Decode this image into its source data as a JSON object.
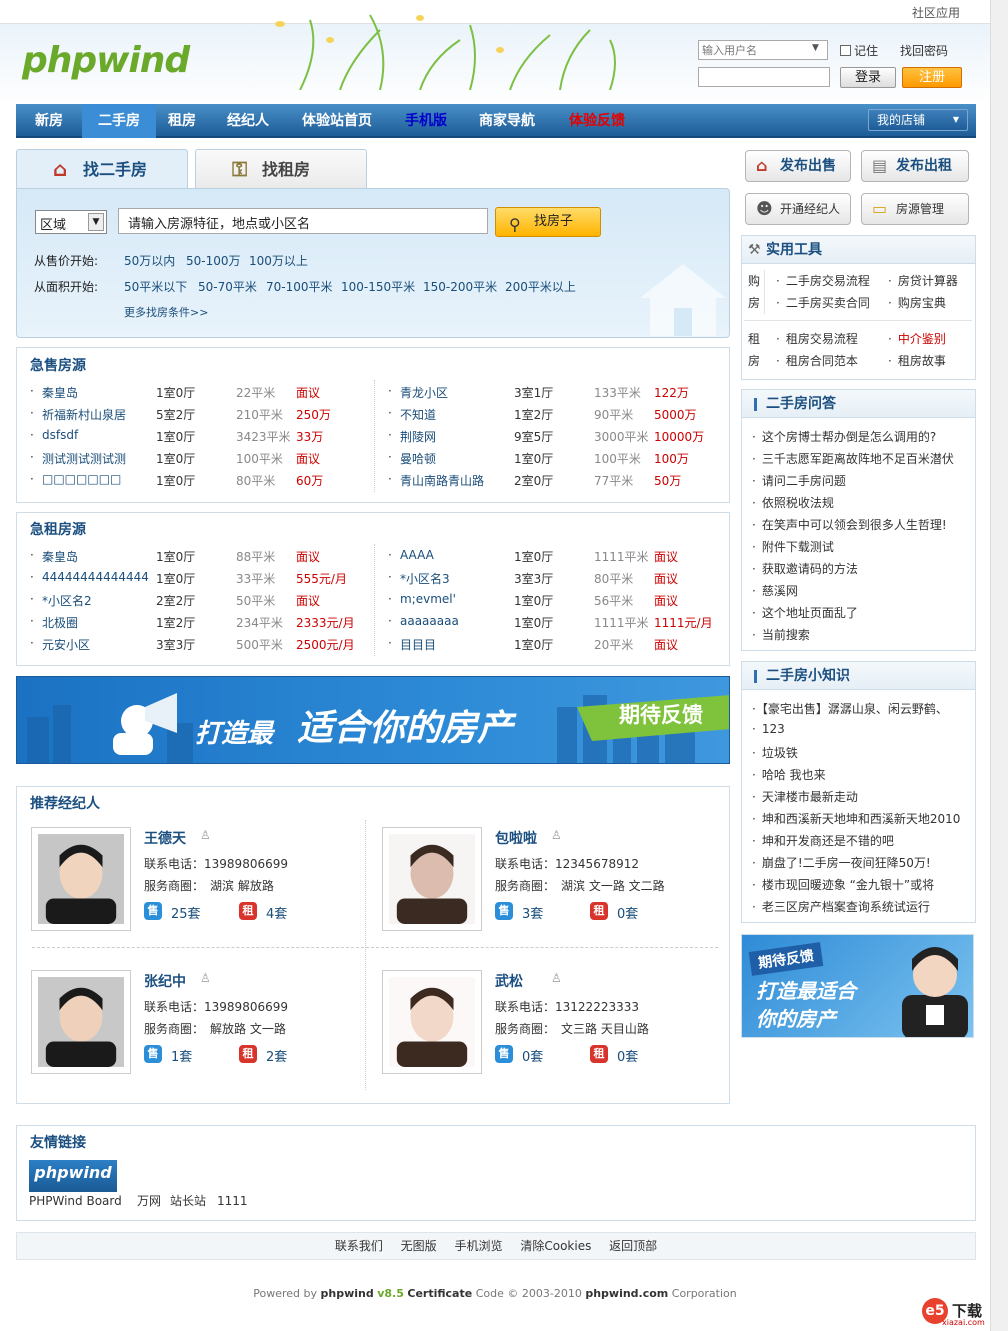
{
  "topbar": {
    "app_label": "社区应用"
  },
  "brand": {
    "logo_text": "phpwind"
  },
  "login": {
    "user_placeholder": "输入用户名",
    "remember_label": "记住",
    "find_password": "找回密码",
    "login_button": "登录",
    "register_button": "注册"
  },
  "nav": {
    "items": [
      "新房",
      "二手房",
      "租房",
      "经纪人",
      "体验站首页",
      "手机版",
      "商家导航",
      "体验反馈"
    ],
    "active": "二手房",
    "my_shop": "我的店铺"
  },
  "search": {
    "tabs": [
      "找二手房",
      "找租房"
    ],
    "area_select": "区域",
    "keyword_placeholder": "请输入房源特征，地点或小区名",
    "button": "找房子",
    "price_label": "从售价开始:",
    "price_options": [
      "50万以内",
      "50-100万",
      "100万以上"
    ],
    "area_label": "从面积开始:",
    "area_options": [
      "50平米以下",
      "50-70平米",
      "70-100平米",
      "100-150平米",
      "150-200平米",
      "200平米以上"
    ],
    "more": "更多找房条件>>"
  },
  "urgent_sale": {
    "title": "急售房源",
    "left": [
      {
        "name": "秦皇岛",
        "layout": "1室0厅",
        "size": "22平米",
        "price": "面议"
      },
      {
        "name": "祈福新村山泉居",
        "layout": "5室2厅",
        "size": "210平米",
        "price": "250万"
      },
      {
        "name": "dsfsdf",
        "layout": "1室0厅",
        "size": "3423平米",
        "price": "33万"
      },
      {
        "name": "测试测试测试测",
        "layout": "1室0厅",
        "size": "100平米",
        "price": "面议"
      },
      {
        "name": "□□□□□□□",
        "layout": "1室0厅",
        "size": "80平米",
        "price": "60万"
      }
    ],
    "right": [
      {
        "name": "青龙小区",
        "layout": "3室1厅",
        "size": "133平米",
        "price": "122万"
      },
      {
        "name": "不知道",
        "layout": "1室2厅",
        "size": "90平米",
        "price": "5000万"
      },
      {
        "name": "荆陵网",
        "layout": "9室5厅",
        "size": "3000平米",
        "price": "10000万"
      },
      {
        "name": "曼哈顿",
        "layout": "1室0厅",
        "size": "100平米",
        "price": "100万"
      },
      {
        "name": "青山南路青山路",
        "layout": "2室0厅",
        "size": "77平米",
        "price": "50万"
      }
    ]
  },
  "urgent_rent": {
    "title": "急租房源",
    "left": [
      {
        "name": "秦皇岛",
        "layout": "1室0厅",
        "size": "88平米",
        "price": "面议"
      },
      {
        "name": "44444444444444",
        "layout": "1室0厅",
        "size": "33平米",
        "price": "555元/月"
      },
      {
        "name": "*小区名2",
        "layout": "2室2厅",
        "size": "50平米",
        "price": "面议"
      },
      {
        "name": "北极圈",
        "layout": "1室2厅",
        "size": "234平米",
        "price": "2333元/月"
      },
      {
        "name": "元安小区",
        "layout": "3室3厅",
        "size": "500平米",
        "price": "2500元/月"
      }
    ],
    "right": [
      {
        "name": "AAAA",
        "layout": "1室0厅",
        "size": "1111平米",
        "price": "面议"
      },
      {
        "name": "*小区名3",
        "layout": "3室3厅",
        "size": "80平米",
        "price": "面议"
      },
      {
        "name": "m;evmel'",
        "layout": "1室0厅",
        "size": "56平米",
        "price": "面议"
      },
      {
        "name": "aaaaaaaa",
        "layout": "1室0厅",
        "size": "1111平米",
        "price": "1111元/月"
      },
      {
        "name": "目目目",
        "layout": "1室0厅",
        "size": "20平米",
        "price": "面议"
      }
    ]
  },
  "banner": {
    "text_a": "打造最",
    "text_b": "适合你的房产",
    "tag": "期待反馈"
  },
  "agents": {
    "title": "推荐经纪人",
    "phone_label": "联系电话：",
    "area_label": "服务商圈：",
    "sale_icon": "售",
    "rent_icon": "租",
    "list": [
      {
        "name": "王德天",
        "phone": "13989806699",
        "areas": "湖滨 解放路",
        "sale": "25套",
        "rent": "4套"
      },
      {
        "name": "包啦啦",
        "phone": "12345678912",
        "areas": "湖滨 文一路 文二路",
        "sale": "3套",
        "rent": "0套"
      },
      {
        "name": "张纪中",
        "phone": "13989806699",
        "areas": "解放路 文一路",
        "sale": "1套",
        "rent": "2套"
      },
      {
        "name": "武松",
        "phone": "13122223333",
        "areas": "文三路 天目山路",
        "sale": "0套",
        "rent": "0套"
      }
    ]
  },
  "links": {
    "title": "友情链接",
    "logo_text": "phpwind",
    "items": [
      "PHPWind Board",
      "万网",
      "站长站",
      "1111"
    ]
  },
  "right": {
    "buttons": [
      "发布出售",
      "发布出租",
      "开通经纪人",
      "房源管理"
    ],
    "tools": {
      "title": "实用工具",
      "buy_label": "购房",
      "buy_items": [
        "二手房交易流程",
        "房贷计算器",
        "二手房买卖合同",
        "购房宝典"
      ],
      "rent_label": "租房",
      "rent_items": [
        "租房交易流程",
        "中介鉴别",
        "租房合同范本",
        "租房故事"
      ]
    },
    "qa": {
      "title": "二手房问答",
      "items": [
        "这个房博士帮办倒是怎么调用的?",
        "三千志愿军距离故阵地不足百米潜伏",
        "请问二手房问题",
        "依照税收法规",
        "在笑声中可以领会到很多人生哲理!",
        "附件下载测试",
        "获取邀请码的方法",
        "慈溪网",
        "这个地址页面乱了",
        "当前搜索"
      ]
    },
    "knowledge": {
      "title": "二手房小知识",
      "items": [
        "【豪宅出售】潺潺山泉、闲云野鹤、",
        "123",
        "垃圾铁",
        "哈哈 我也来",
        "天津楼市最新走动",
        "坤和西溪新天地坤和西溪新天地2010",
        "坤和开发商还是不错的吧",
        "崩盘了!二手房一夜间狂降50万!",
        "楼市现回暖迹象 “金九银十”或将",
        "老三区房产档案查询系统试运行"
      ]
    },
    "ad": {
      "tag": "期待反馈",
      "line1": "打造最适合",
      "line2": "你的房产"
    }
  },
  "footer": {
    "links": [
      "联系我们",
      "无图版",
      "手机浏览",
      "清除Cookies",
      "返回顶部"
    ],
    "powered_pre": "Powered by",
    "powered_brand": "phpwind",
    "powered_version": "v8.5",
    "powered_cert": "Certificate",
    "powered_mid": "Code © 2003-2010",
    "powered_site": "phpwind.com",
    "powered_post": "Corporation"
  },
  "watermark": {
    "text": "下载",
    "sub": "xiazai.com"
  }
}
